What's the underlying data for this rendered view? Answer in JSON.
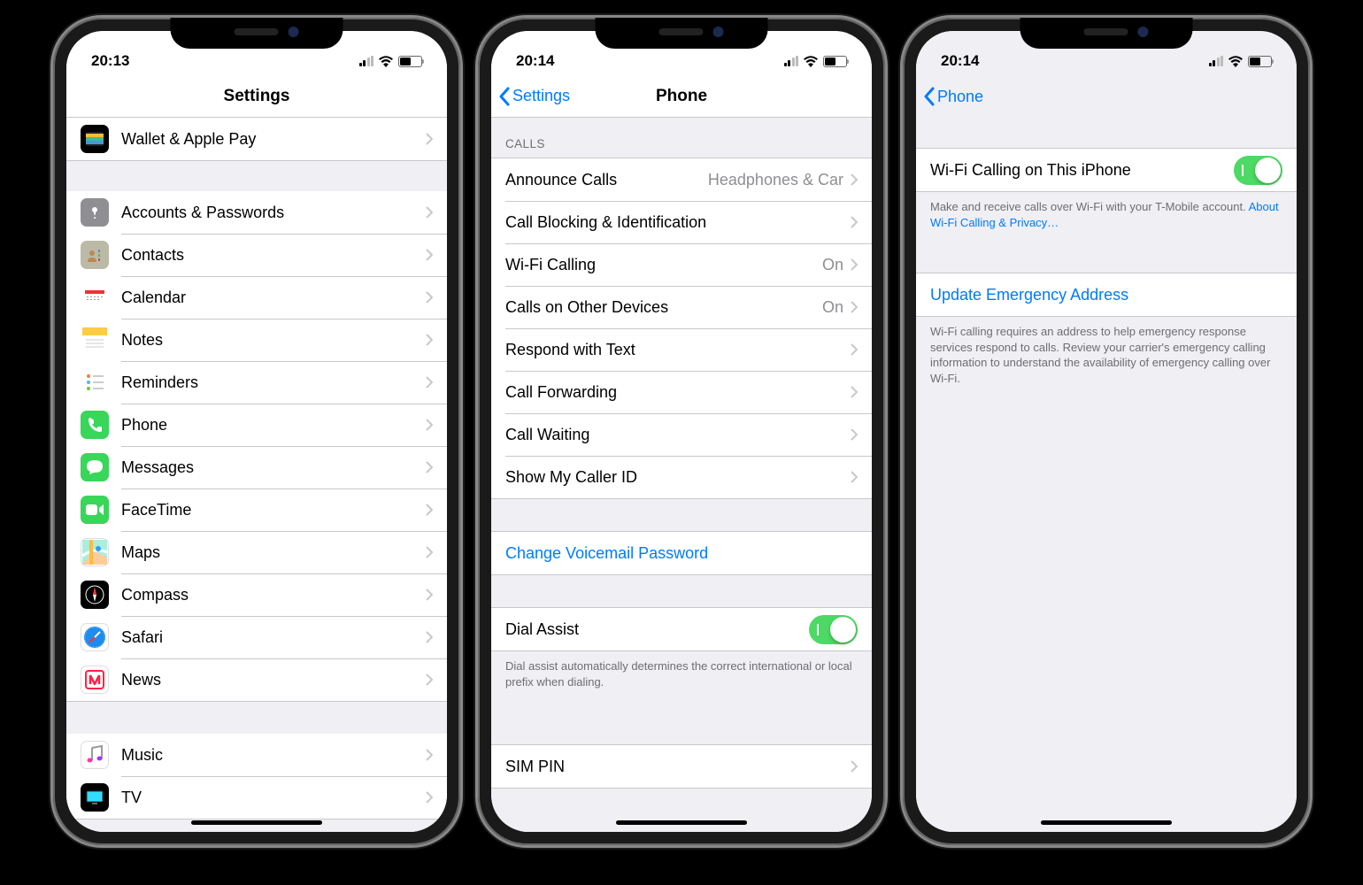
{
  "screen1": {
    "time": "20:13",
    "title": "Settings",
    "topRow": {
      "label": "Wallet & Apple Pay"
    },
    "group1": [
      {
        "id": "accounts",
        "label": "Accounts & Passwords"
      },
      {
        "id": "contacts",
        "label": "Contacts"
      },
      {
        "id": "calendar",
        "label": "Calendar"
      },
      {
        "id": "notes",
        "label": "Notes"
      },
      {
        "id": "reminders",
        "label": "Reminders"
      },
      {
        "id": "phone",
        "label": "Phone"
      },
      {
        "id": "messages",
        "label": "Messages"
      },
      {
        "id": "facetime",
        "label": "FaceTime"
      },
      {
        "id": "maps",
        "label": "Maps"
      },
      {
        "id": "compass",
        "label": "Compass"
      },
      {
        "id": "safari",
        "label": "Safari"
      },
      {
        "id": "news",
        "label": "News"
      }
    ],
    "group2": [
      {
        "id": "music",
        "label": "Music"
      },
      {
        "id": "tv",
        "label": "TV"
      }
    ]
  },
  "screen2": {
    "time": "20:14",
    "backLabel": "Settings",
    "title": "Phone",
    "callsHeader": "CALLS",
    "calls": [
      {
        "label": "Announce Calls",
        "detail": "Headphones & Car"
      },
      {
        "label": "Call Blocking & Identification",
        "detail": ""
      },
      {
        "label": "Wi-Fi Calling",
        "detail": "On"
      },
      {
        "label": "Calls on Other Devices",
        "detail": "On"
      },
      {
        "label": "Respond with Text",
        "detail": ""
      },
      {
        "label": "Call Forwarding",
        "detail": ""
      },
      {
        "label": "Call Waiting",
        "detail": ""
      },
      {
        "label": "Show My Caller ID",
        "detail": ""
      }
    ],
    "voicemail": "Change Voicemail Password",
    "dialAssist": {
      "label": "Dial Assist",
      "footer": "Dial assist automatically determines the correct international or local prefix when dialing."
    },
    "sim": "SIM PIN"
  },
  "screen3": {
    "time": "20:14",
    "backLabel": "Phone",
    "wifiCalling": {
      "label": "Wi-Fi Calling on This iPhone",
      "footer": "Make and receive calls over Wi-Fi with your T-Mobile account. ",
      "footerLink": "About Wi-Fi Calling & Privacy…"
    },
    "emergency": {
      "label": "Update Emergency Address",
      "footer": "Wi-Fi calling requires an address to help emergency response services respond to calls. Review your carrier's emergency calling information to understand the availability of emergency calling over Wi-Fi."
    }
  },
  "iconColors": {
    "wallet": "#000",
    "accounts": "#8e8e93",
    "contacts": "#bcb9a6",
    "calendar": "#fff",
    "notes": "#fff",
    "reminders": "#fff",
    "phone": "#38d659",
    "messages": "#38d659",
    "facetime": "#38d659",
    "maps": "#fff",
    "compass": "#000",
    "safari": "#1485f0",
    "news": "#fff",
    "music": "#fff",
    "tv": "#000"
  }
}
